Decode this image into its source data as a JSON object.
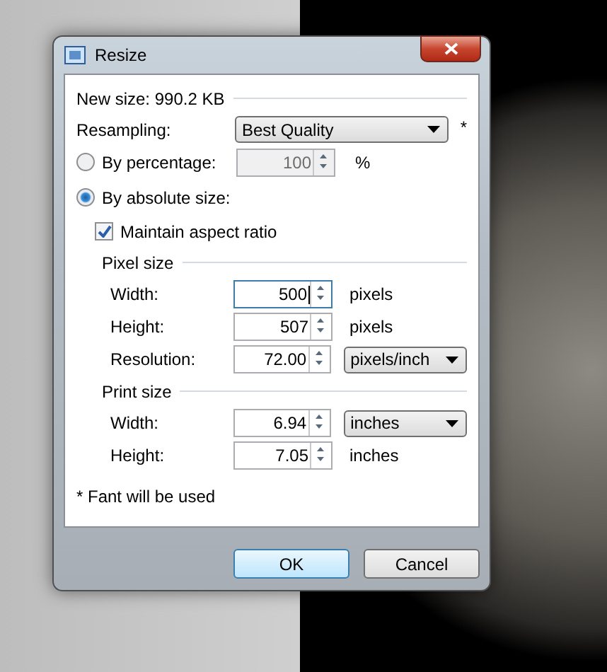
{
  "window": {
    "title": "Resize"
  },
  "new_size": "New size: 990.2 KB",
  "resampling": {
    "label": "Resampling:",
    "value": "Best Quality",
    "note": "*"
  },
  "modes": [
    {
      "label": "By percentage:",
      "selected": false
    },
    {
      "label": "By absolute size:",
      "selected": true
    }
  ],
  "percentage": {
    "value": "100",
    "unit": "%",
    "disabled": true
  },
  "maintain_aspect": {
    "label": "Maintain aspect ratio",
    "checked": true
  },
  "groups": [
    {
      "title": "Pixel size",
      "rows": [
        {
          "label": "Width:",
          "value": "500",
          "unit": "pixels",
          "kind": "text",
          "focused": true
        },
        {
          "label": "Height:",
          "value": "507",
          "unit": "pixels",
          "kind": "text",
          "focused": false
        },
        {
          "label": "Resolution:",
          "value": "72.00",
          "unit": "pixels/inch",
          "kind": "dropdown",
          "focused": false
        }
      ]
    },
    {
      "title": "Print size",
      "rows": [
        {
          "label": "Width:",
          "value": "6.94",
          "unit": "inches",
          "kind": "dropdown",
          "focused": false
        },
        {
          "label": "Height:",
          "value": "7.05",
          "unit": "inches",
          "kind": "text",
          "focused": false
        }
      ]
    }
  ],
  "footnote": "* Fant will be used",
  "buttons": [
    {
      "label": "OK",
      "default": true
    },
    {
      "label": "Cancel",
      "default": false
    }
  ]
}
